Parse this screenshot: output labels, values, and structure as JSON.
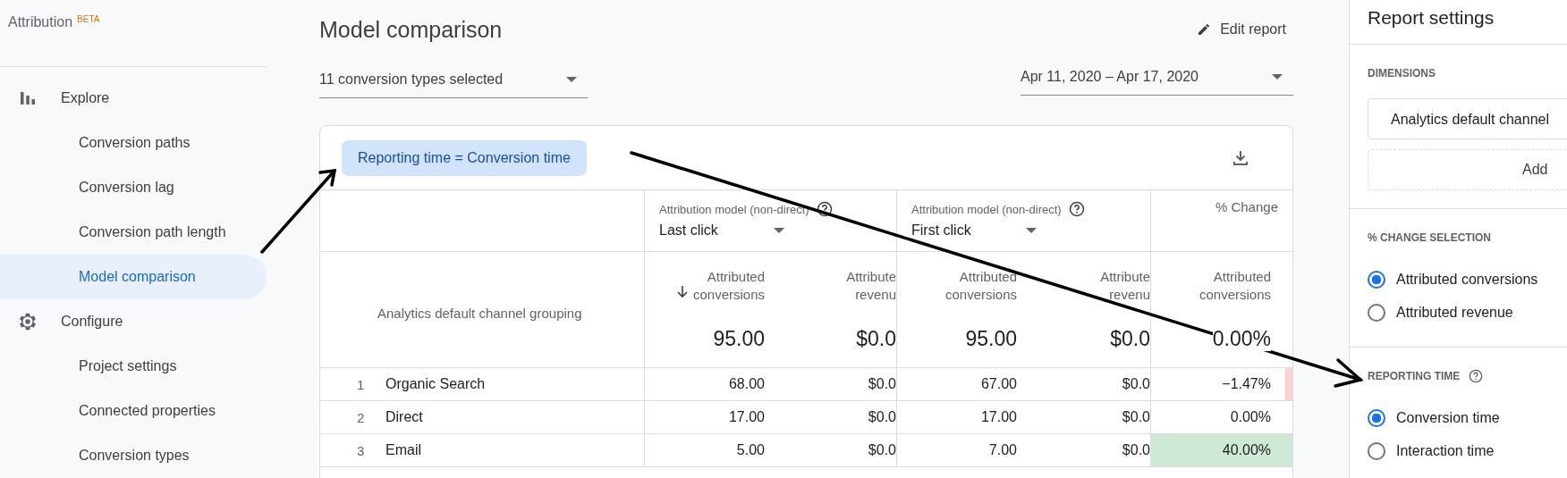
{
  "sidebar": {
    "brand": "Attribution",
    "badge": "BETA",
    "sections": [
      {
        "label": "Explore",
        "items": [
          {
            "label": "Conversion paths",
            "selected": false
          },
          {
            "label": "Conversion lag",
            "selected": false
          },
          {
            "label": "Conversion path length",
            "selected": false
          },
          {
            "label": "Model comparison",
            "selected": true
          }
        ]
      },
      {
        "label": "Configure",
        "items": [
          {
            "label": "Project settings",
            "selected": false
          },
          {
            "label": "Connected properties",
            "selected": false
          },
          {
            "label": "Conversion types",
            "selected": false
          }
        ]
      }
    ]
  },
  "header": {
    "title": "Model comparison",
    "edit_button": "Edit report"
  },
  "filters": {
    "conversion_types": "11 conversion types selected",
    "date_range": "Apr 11, 2020 – Apr 17, 2020"
  },
  "table": {
    "chip": "Reporting time = Conversion time",
    "models": [
      {
        "caption": "Attribution model (non-direct)",
        "value": "Last click"
      },
      {
        "caption": "Attribution model (non-direct)",
        "value": "First click"
      }
    ],
    "change_heading": "% Change",
    "dimension_heading": "Analytics default channel grouping",
    "metric_columns": [
      {
        "heading": "Attributed\nconversions",
        "sorted": true,
        "total": "95.00"
      },
      {
        "heading": "Attribute\nrevenu",
        "total": "$0.0"
      },
      {
        "heading": "Attributed\nconversions",
        "total": "95.00"
      },
      {
        "heading": "Attribute\nrevenu",
        "total": "$0.0"
      },
      {
        "heading": "Attributed\nconversions",
        "total": "0.00%"
      }
    ],
    "rows": [
      {
        "num": "1",
        "channel": "Organic Search",
        "values": [
          "68.00",
          "$0.0",
          "67.00",
          "$0.0"
        ],
        "change": "−1.47%",
        "color": "#fad2cf",
        "level": 0.05
      },
      {
        "num": "2",
        "channel": "Direct",
        "values": [
          "17.00",
          "$0.0",
          "17.00",
          "$0.0"
        ],
        "change": "0.00%"
      },
      {
        "num": "3",
        "channel": "Email",
        "values": [
          "5.00",
          "$0.0",
          "7.00",
          "$0.0"
        ],
        "change": "40.00%",
        "color": "#ceead6",
        "level": 1
      }
    ]
  },
  "settings": {
    "title": "Report settings",
    "sections": [
      {
        "kind": "dimensions",
        "heading": "DIMENSIONS",
        "field": "Analytics default channel",
        "add": "Add"
      },
      {
        "kind": "radios",
        "heading": "% CHANGE SELECTION",
        "options": [
          {
            "label": "Attributed conversions",
            "selected": true
          },
          {
            "label": "Attributed revenue",
            "selected": false
          }
        ]
      },
      {
        "kind": "radios",
        "heading": "REPORTING TIME",
        "help": true,
        "options": [
          {
            "label": "Conversion time",
            "selected": true
          },
          {
            "label": "Interaction time",
            "selected": false
          }
        ]
      }
    ]
  }
}
